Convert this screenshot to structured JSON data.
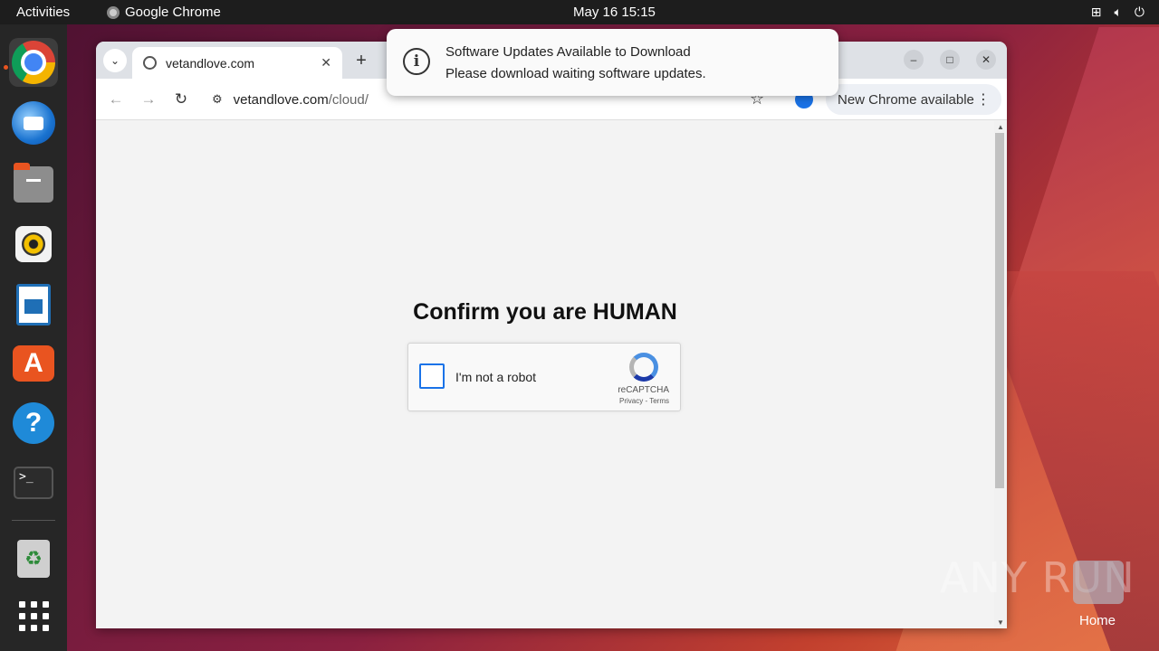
{
  "topbar": {
    "activities": "Activities",
    "app_name": "Google Chrome",
    "clock": "May 16  15:15"
  },
  "dock": {
    "items": [
      "chrome-icon",
      "thunderbird-icon",
      "files-icon",
      "rhythmbox-icon",
      "writer-icon",
      "app-center-icon",
      "help-icon",
      "terminal-icon",
      "trash-icon",
      "show-apps-icon"
    ]
  },
  "browser": {
    "tab_title": "vetandlove.com",
    "url_host": "vetandlove.com",
    "url_path": "/cloud/",
    "update_chip": "New Chrome available"
  },
  "page": {
    "headline": "Confirm you are HUMAN",
    "captcha_label": "I'm not a robot",
    "captcha_brand": "reCAPTCHA",
    "captcha_terms": "Privacy - Terms"
  },
  "notification": {
    "title": "Software Updates Available to Download",
    "body": "Please download waiting software updates."
  },
  "desktop": {
    "home_label": "Home",
    "watermark": "ANY RUN"
  },
  "colors": {
    "accent": "#e95420",
    "link_blue": "#1a73e8"
  }
}
